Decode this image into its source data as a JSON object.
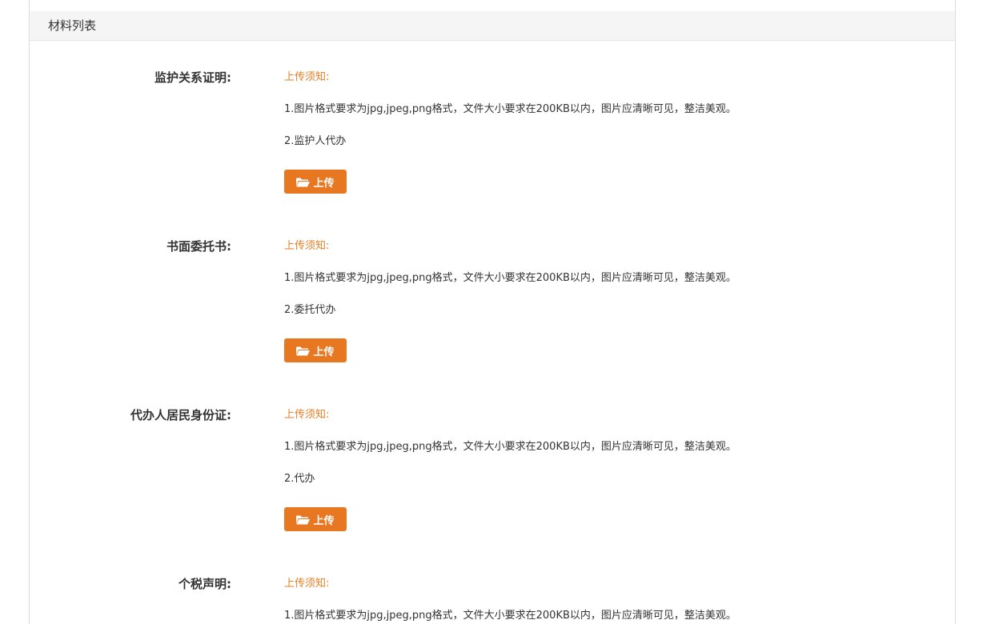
{
  "section": {
    "title": "材料列表"
  },
  "materials": [
    {
      "label": "监护关系证明:",
      "notice_title": "上传须知:",
      "line1": "1.图片格式要求为jpg,jpeg,png格式，文件大小要求在200KB以内，图片应清晰可见，整洁美观。",
      "line2": "2.监护人代办",
      "upload_label": "上传",
      "upload_icon": "folder-open-icon"
    },
    {
      "label": "书面委托书:",
      "notice_title": "上传须知:",
      "line1": "1.图片格式要求为jpg,jpeg,png格式，文件大小要求在200KB以内，图片应清晰可见，整洁美观。",
      "line2": "2.委托代办",
      "upload_label": "上传",
      "upload_icon": "folder-open-icon"
    },
    {
      "label": "代办人居民身份证:",
      "notice_title": "上传须知:",
      "line1": "1.图片格式要求为jpg,jpeg,png格式，文件大小要求在200KB以内，图片应清晰可见，整洁美观。",
      "line2": "2.代办",
      "upload_label": "上传",
      "upload_icon": "folder-open-icon"
    },
    {
      "label": "个税声明:",
      "notice_title": "上传须知:",
      "line1": "1.图片格式要求为jpg,jpeg,png格式，文件大小要求在200KB以内，图片应清晰可见，整洁美观。"
    }
  ],
  "colors": {
    "accent": "#e87722",
    "notice": "#e87e22",
    "header_bg": "#f5f5f5"
  }
}
